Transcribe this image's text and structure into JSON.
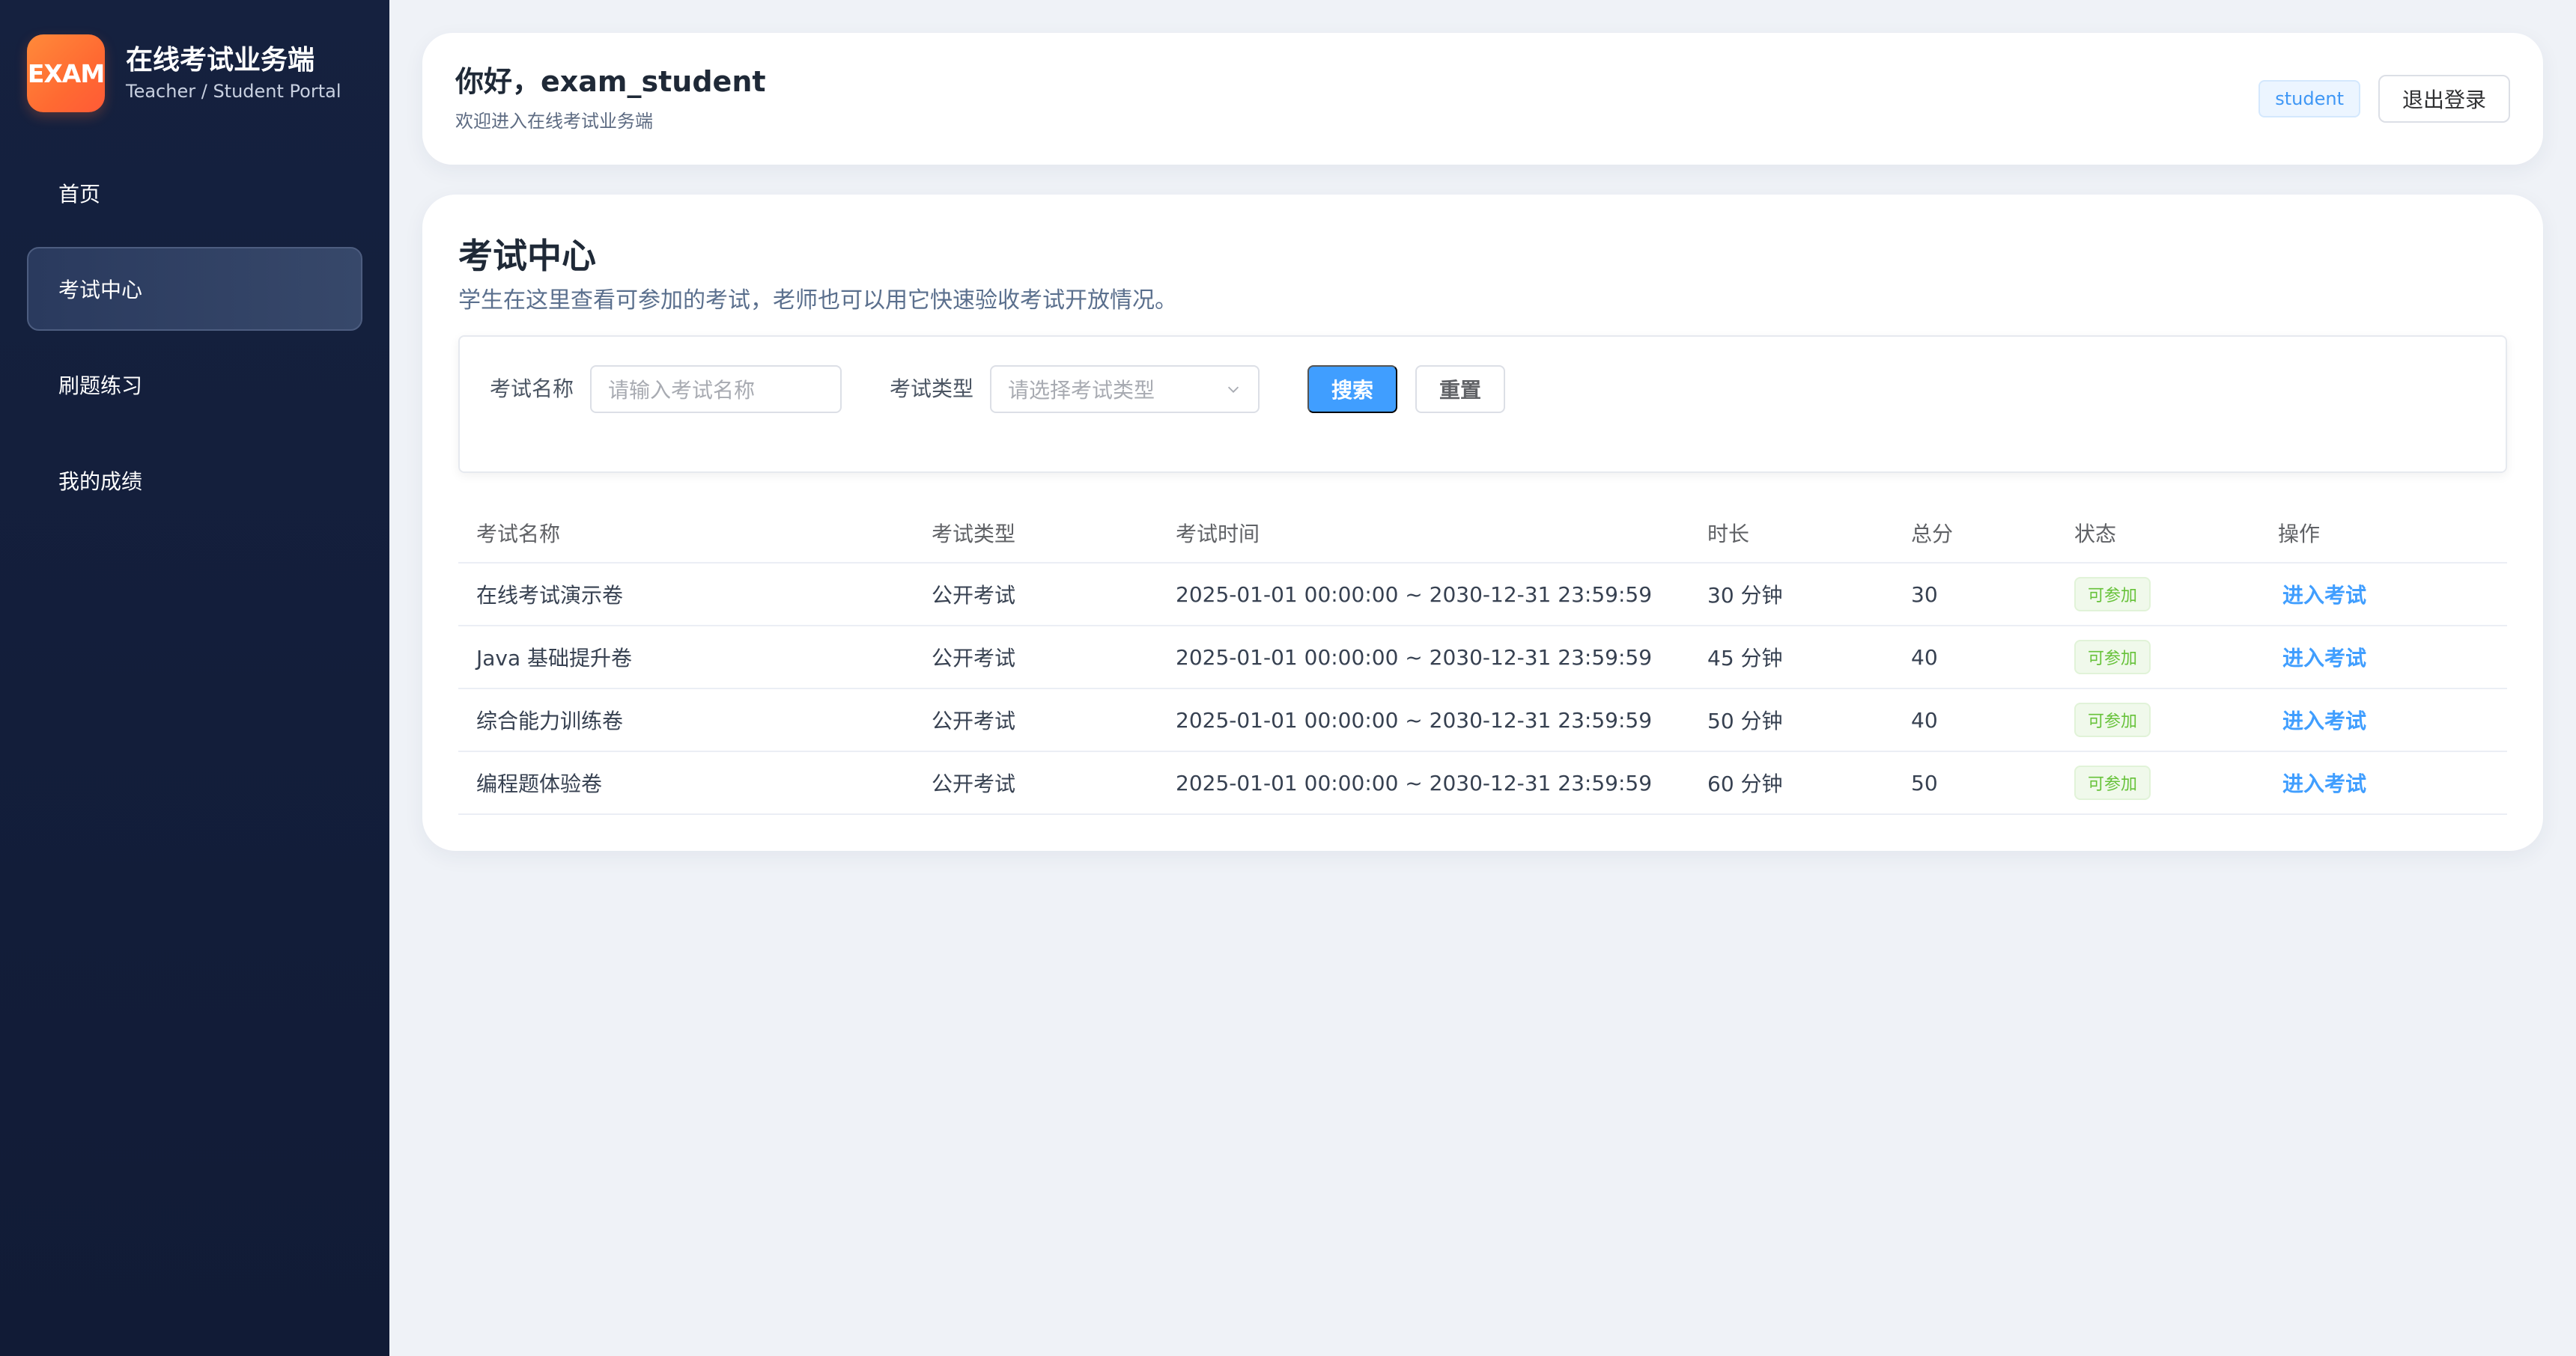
{
  "sidebar": {
    "logo_text": "EXAM",
    "title": "在线考试业务端",
    "subtitle": "Teacher / Student Portal",
    "items": [
      {
        "label": "首页",
        "active": false
      },
      {
        "label": "考试中心",
        "active": true
      },
      {
        "label": "刷题练习",
        "active": false
      },
      {
        "label": "我的成绩",
        "active": false
      }
    ]
  },
  "header": {
    "greeting": "你好，exam_student",
    "welcome": "欢迎进入在线考试业务端",
    "role_tag": "student",
    "logout_label": "退出登录"
  },
  "main": {
    "title": "考试中心",
    "description": "学生在这里查看可参加的考试，老师也可以用它快速验收考试开放情况。",
    "filters": {
      "name_label": "考试名称",
      "name_placeholder": "请输入考试名称",
      "type_label": "考试类型",
      "type_placeholder": "请选择考试类型",
      "search_label": "搜索",
      "reset_label": "重置"
    },
    "table": {
      "columns": [
        "考试名称",
        "考试类型",
        "考试时间",
        "时长",
        "总分",
        "状态",
        "操作"
      ],
      "rows": [
        {
          "name": "在线考试演示卷",
          "type": "公开考试",
          "time": "2025-01-01 00:00:00 ~ 2030-12-31 23:59:59",
          "duration": "30 分钟",
          "score": "30",
          "status": "可参加",
          "action": "进入考试"
        },
        {
          "name": "Java 基础提升卷",
          "type": "公开考试",
          "time": "2025-01-01 00:00:00 ~ 2030-12-31 23:59:59",
          "duration": "45 分钟",
          "score": "40",
          "status": "可参加",
          "action": "进入考试"
        },
        {
          "name": "综合能力训练卷",
          "type": "公开考试",
          "time": "2025-01-01 00:00:00 ~ 2030-12-31 23:59:59",
          "duration": "50 分钟",
          "score": "40",
          "status": "可参加",
          "action": "进入考试"
        },
        {
          "name": "编程题体验卷",
          "type": "公开考试",
          "time": "2025-01-01 00:00:00 ~ 2030-12-31 23:59:59",
          "duration": "60 分钟",
          "score": "50",
          "status": "可参加",
          "action": "进入考试"
        }
      ]
    }
  },
  "colors": {
    "sidebar_bg": "#131e3b",
    "accent": "#409eff",
    "logo": "#ff7a36",
    "success": "#67c23a"
  },
  "icons": {
    "select_arrow": "chevron-down-icon"
  }
}
